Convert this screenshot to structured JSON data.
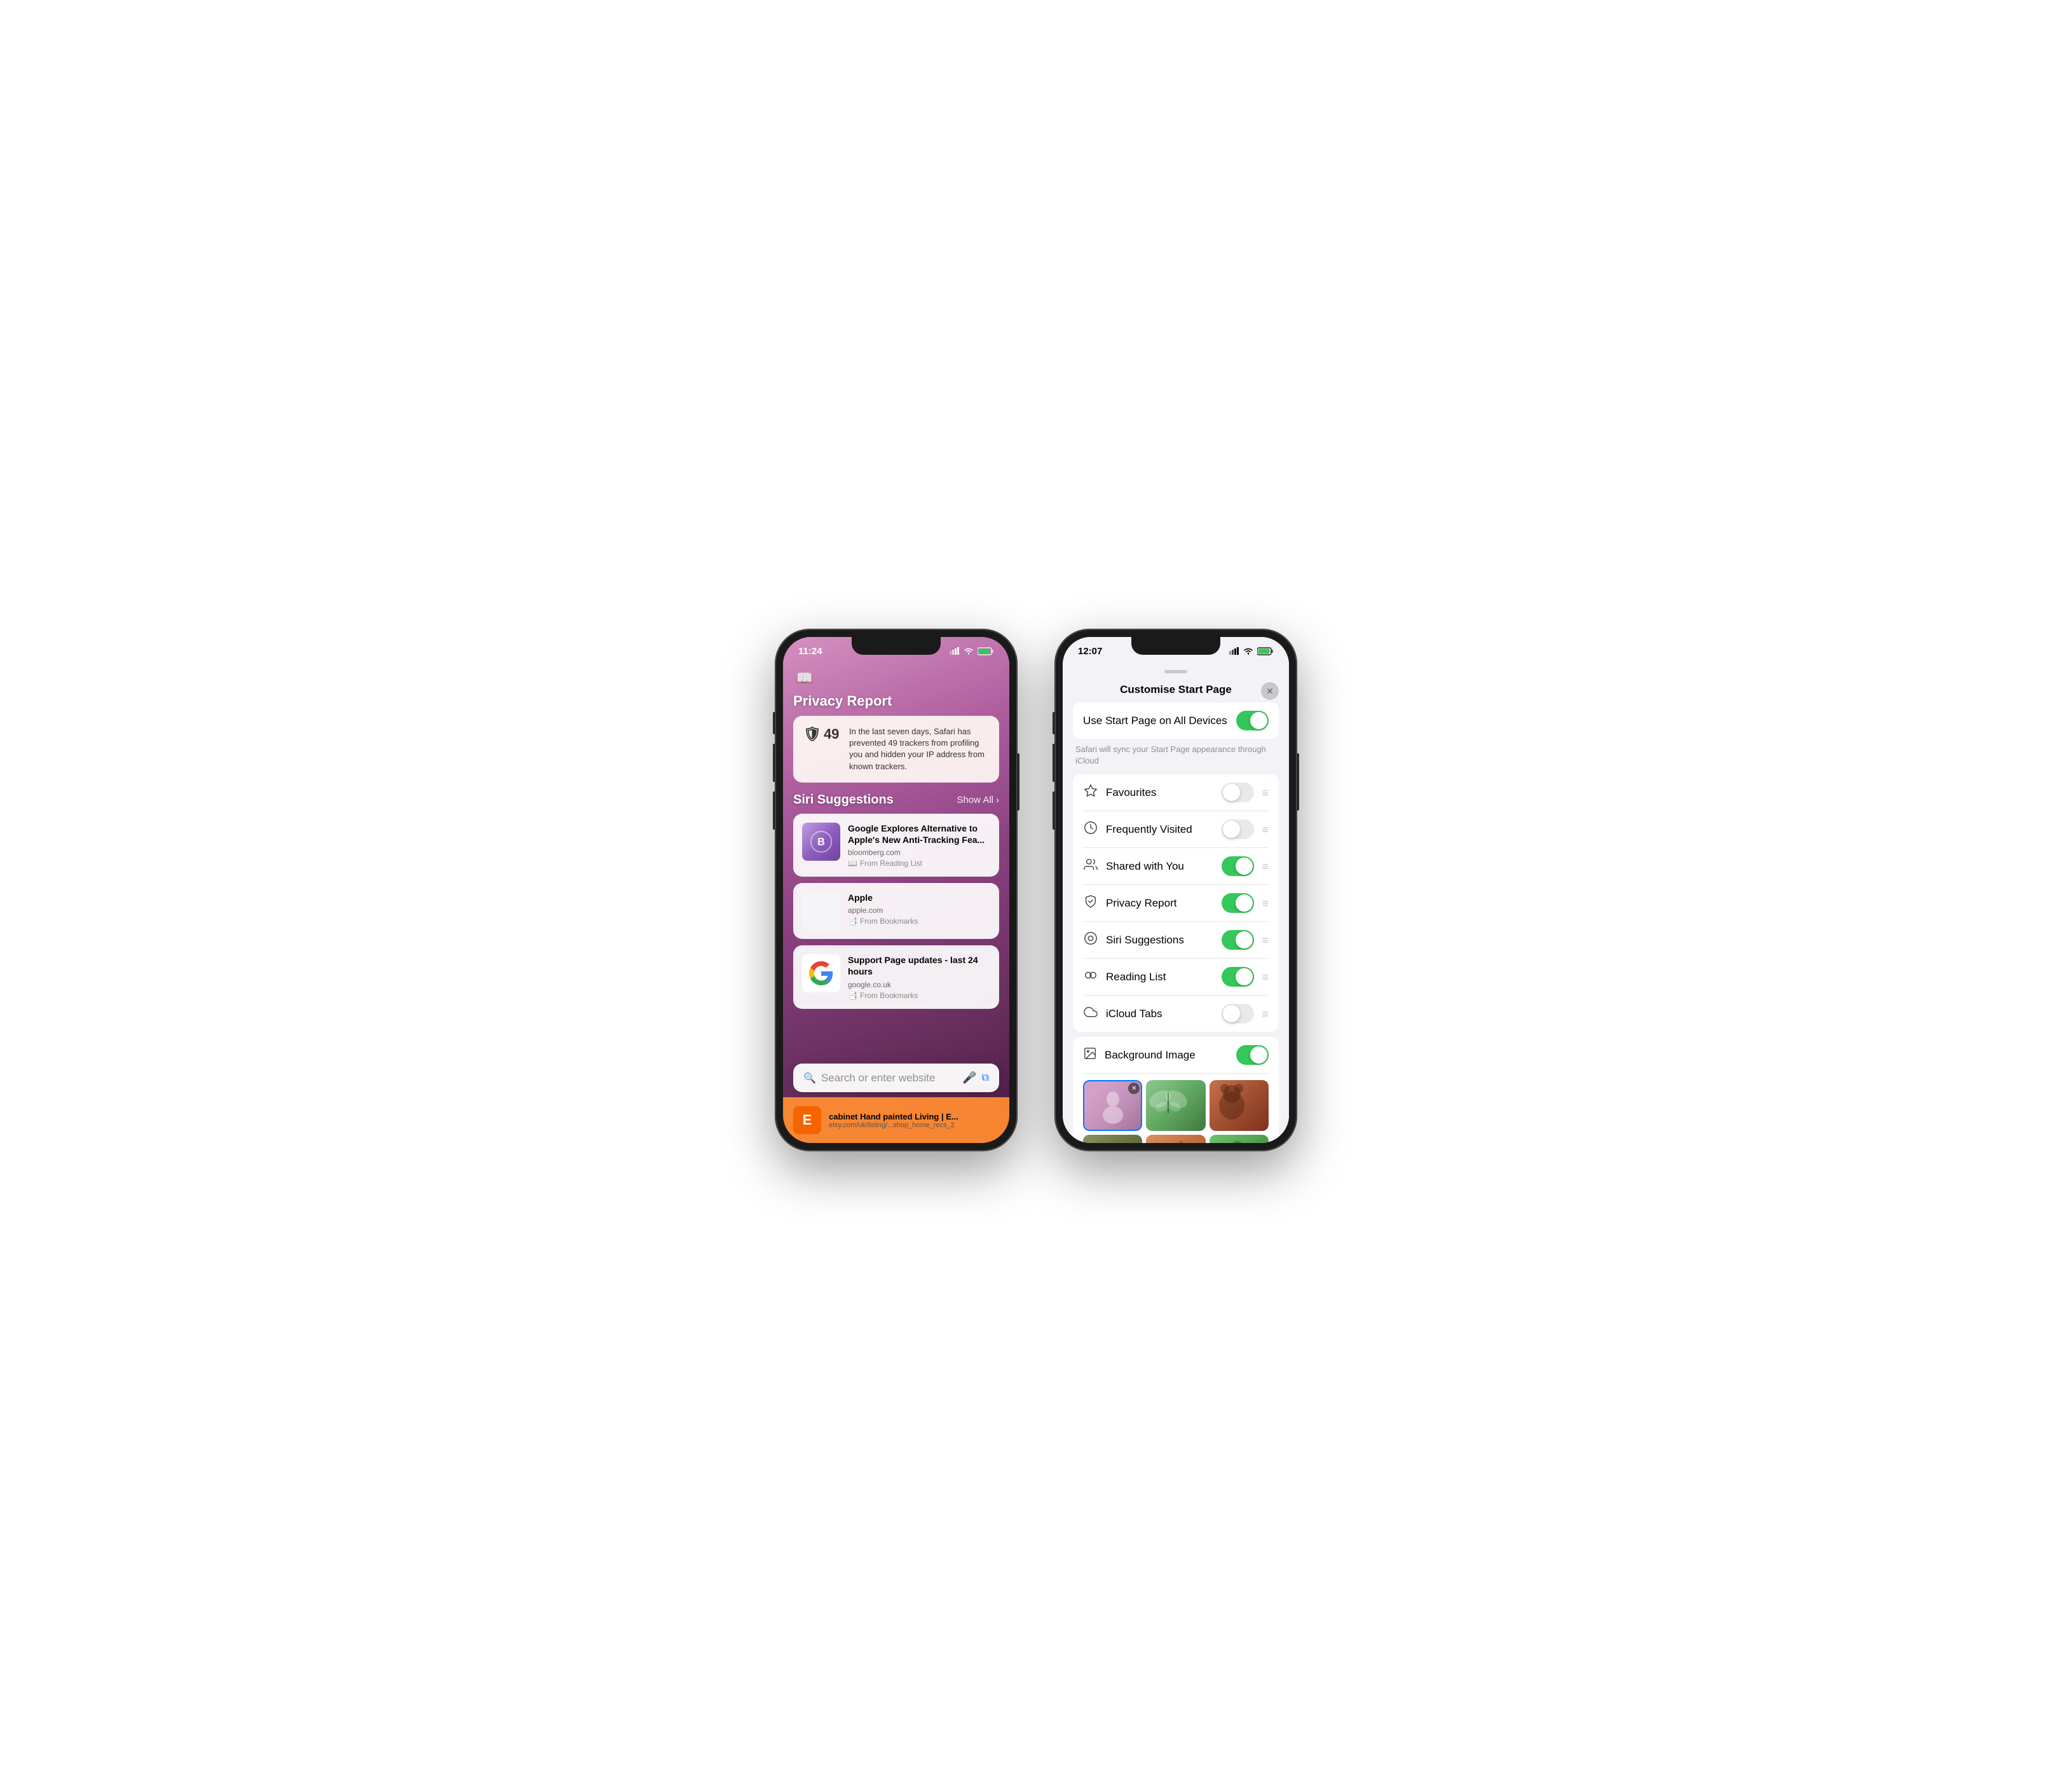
{
  "phone1": {
    "status": {
      "time": "11:24",
      "signal": "wifi",
      "battery": "charging"
    },
    "sections": {
      "book_icon": "📖",
      "privacy_report": {
        "title": "Privacy Report",
        "card_text": "In the last seven days, Safari has prevented 49 trackers from profiling you and hidden your IP address from known trackers.",
        "tracker_count": "49"
      },
      "siri_suggestions": {
        "title": "Siri Suggestions",
        "show_all": "Show All",
        "items": [
          {
            "title": "Google Explores Alternative to Apple's New Anti-Tracking Fea...",
            "url": "bloomberg.com",
            "source": "From Reading List"
          },
          {
            "title": "Apple",
            "url": "apple.com",
            "source": "From Bookmarks"
          },
          {
            "title": "Support Page updates - last 24 hours",
            "url": "google.co.uk",
            "source": "From Bookmarks"
          }
        ]
      },
      "search": {
        "placeholder": "Search or enter website"
      },
      "bottom_suggestion": {
        "title": "cabinet Hand painted Living | E...",
        "url": "etsy.com/uk/listing/...shop_home_recs_2",
        "label": "E"
      }
    }
  },
  "phone2": {
    "status": {
      "time": "12:07"
    },
    "sheet": {
      "title": "Customise Start Page",
      "close_label": "✕",
      "icloud_toggle": {
        "label": "Use Start Page on All Devices",
        "state": "on"
      },
      "icloud_note": "Safari will sync your Start Page appearance through iCloud",
      "items": [
        {
          "icon": "☆",
          "label": "Favourites",
          "state": "off",
          "show_drag": true
        },
        {
          "icon": "⊙",
          "label": "Frequently Visited",
          "state": "off",
          "show_drag": true
        },
        {
          "icon": "👥",
          "label": "Shared with You",
          "state": "on",
          "show_drag": true
        },
        {
          "icon": "🛡",
          "label": "Privacy Report",
          "state": "on",
          "show_drag": true
        },
        {
          "icon": "◎",
          "label": "Siri Suggestions",
          "state": "on",
          "show_drag": true
        },
        {
          "icon": "◯◯",
          "label": "Reading List",
          "state": "on",
          "show_drag": true
        },
        {
          "icon": "☁",
          "label": "iCloud Tabs",
          "state": "off",
          "show_drag": true
        }
      ],
      "background": {
        "icon": "🖼",
        "label": "Background Image",
        "state": "on"
      }
    }
  }
}
